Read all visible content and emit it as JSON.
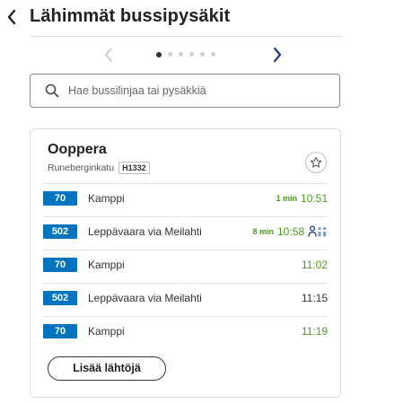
{
  "header": {
    "title": "Lähimmät bussipysäkit"
  },
  "search": {
    "placeholder": "Hae bussilinjaa tai pysäkkiä"
  },
  "stop": {
    "name": "Ooppera",
    "street": "Runeberginkatu",
    "code": "H1332"
  },
  "departures": [
    {
      "line": "70",
      "destination": "Kamppi",
      "minutes": "1 min",
      "time": "10:51",
      "realtime": true,
      "crowding_icon": false
    },
    {
      "line": "502",
      "destination": "Leppävaara via Meilahti",
      "minutes": "8 min",
      "time": "10:58",
      "realtime": true,
      "crowding_icon": true
    },
    {
      "line": "70",
      "destination": "Kamppi",
      "minutes": "",
      "time": "11:02",
      "realtime": true,
      "crowding_icon": false
    },
    {
      "line": "502",
      "destination": "Leppävaara via Meilahti",
      "minutes": "",
      "time": "11:15",
      "realtime": false,
      "crowding_icon": false
    },
    {
      "line": "70",
      "destination": "Kamppi",
      "minutes": "",
      "time": "11:19",
      "realtime": true,
      "crowding_icon": false
    }
  ],
  "more_button": {
    "label": "Lisää lähtöjä"
  },
  "pager": {
    "page_count": 6,
    "active_index": 0
  },
  "colors": {
    "line_badge": "#0074bf",
    "realtime_green": "#4a9a1a"
  }
}
